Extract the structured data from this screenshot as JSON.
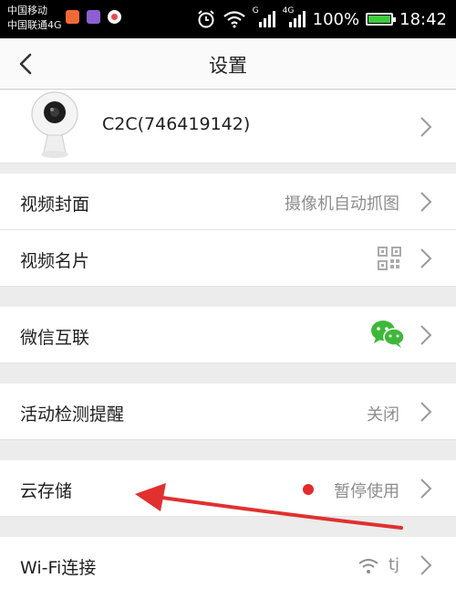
{
  "status_bar": {
    "carrier_1": "中国移动",
    "carrier_2": "中国联通4G",
    "network_1": "G",
    "network_2": "4G",
    "battery_percent": "100%",
    "battery_level": 1.0,
    "time": "18:42",
    "app_icon_colors": [
      "#f06a35",
      "#8d5fd3",
      "#e74b4b"
    ]
  },
  "header": {
    "title": "设置"
  },
  "device": {
    "name": "C2C(746419142)"
  },
  "settings": {
    "video_cover": {
      "label": "视频封面",
      "value": "摄像机自动抓图"
    },
    "video_card": {
      "label": "视频名片"
    },
    "wechat": {
      "label": "微信互联"
    },
    "motion_alert": {
      "label": "活动检测提醒",
      "value": "关闭"
    },
    "cloud_storage": {
      "label": "云存储",
      "value": "暂停使用"
    },
    "wifi": {
      "label": "Wi-Fi连接",
      "value": "tj"
    }
  },
  "colors": {
    "wechat_green": "#3fb83a",
    "annotation_red": "#e0312f",
    "status_dot": "#e32b2b"
  }
}
